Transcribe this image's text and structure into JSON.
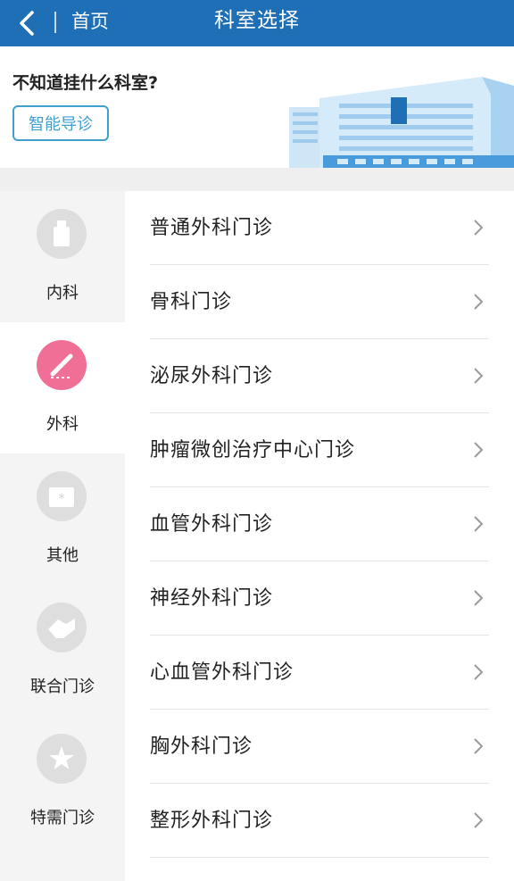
{
  "header": {
    "back_icon": "chevron-left-icon",
    "home_label": "首页",
    "title": "科室选择"
  },
  "banner": {
    "question": "不知道挂什么科室?",
    "guide_button": "智能导诊",
    "illustration": "hospital-building-illustration"
  },
  "colors": {
    "header_bg": "#1f6fb6",
    "accent": "#3f9fce",
    "active_icon": "#f06f97",
    "inactive_icon": "#dedede"
  },
  "categories": [
    {
      "label": "内科",
      "icon": "medicine-bottle-icon",
      "selected": false
    },
    {
      "label": "外科",
      "icon": "scalpel-icon",
      "selected": true
    },
    {
      "label": "其他",
      "icon": "first-aid-kit-icon",
      "selected": false
    },
    {
      "label": "联合门诊",
      "icon": "handshake-icon",
      "selected": false
    },
    {
      "label": "特需门诊",
      "icon": "star-icon",
      "selected": false
    }
  ],
  "departments": [
    "普通外科门诊",
    "骨科门诊",
    "泌尿外科门诊",
    "肿瘤微创治疗中心门诊",
    "血管外科门诊",
    "神经外科门诊",
    "心血管外科门诊",
    "胸外科门诊",
    "整形外科门诊"
  ]
}
